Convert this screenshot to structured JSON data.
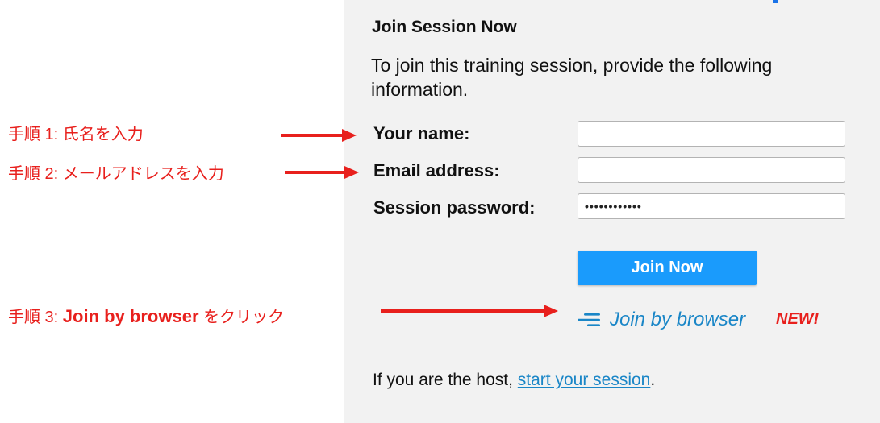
{
  "form": {
    "title": "Join Session Now",
    "intro": "To join this training session, provide the following information.",
    "name_label": "Your name:",
    "name_value": "",
    "email_label": "Email address:",
    "email_value": "",
    "password_label": "Session password:",
    "password_value": "••••••••••••",
    "join_button": "Join Now",
    "join_browser": "Join by browser",
    "new_badge": "NEW!",
    "host_prefix": "If you are the host, ",
    "host_link": "start your session",
    "host_suffix": "."
  },
  "annotations": {
    "step1": "手順 1: 氏名を入力",
    "step2": "手順 2: メールアドレスを入力",
    "step3_prefix": "手順 3: ",
    "step3_bold": "Join by browser",
    "step3_suffix": " をクリック"
  },
  "colors": {
    "annotation_red": "#e8201d",
    "button_blue": "#1a9bfc",
    "link_blue": "#1a86c7",
    "panel_bg": "#f2f2f2"
  },
  "icons": {
    "browser": "join-browser-icon",
    "arrow": "red-arrow"
  }
}
